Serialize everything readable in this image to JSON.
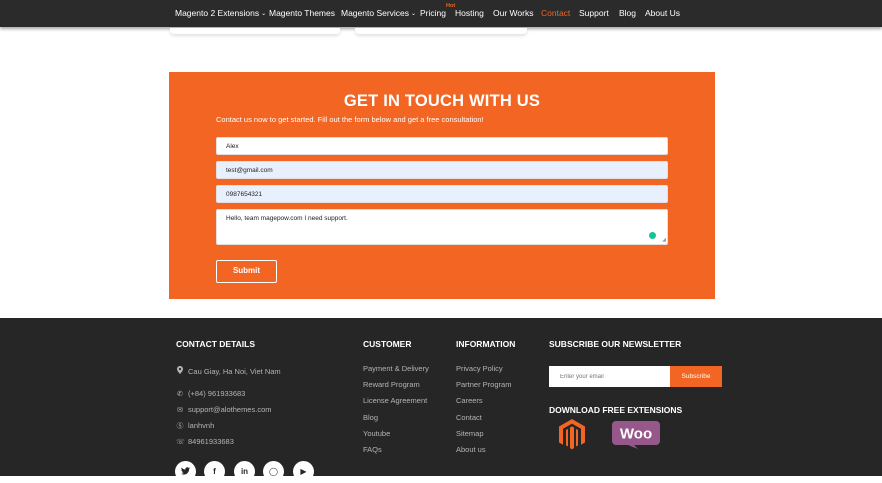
{
  "nav": {
    "items": [
      {
        "label": "Magento 2 Extensions",
        "caret": true
      },
      {
        "label": "Magento Themes"
      },
      {
        "label": "Magento Services",
        "caret": true
      },
      {
        "label": "Pricing"
      },
      {
        "label": "Hosting"
      },
      {
        "label": "Our Works"
      },
      {
        "label": "Contact",
        "active": true
      },
      {
        "label": "Support"
      },
      {
        "label": "Blog"
      },
      {
        "label": "About Us"
      }
    ],
    "hot_badge": "Hot"
  },
  "contact": {
    "title": "GET IN TOUCH WITH US",
    "intro": "Contact us now to get started. Fill out the form below and get a free consultation!",
    "name_value": "Alex",
    "email_value": "test@gmail.com",
    "phone_value": "0987654321",
    "message_value": "Hello, team magepow.com I need support.",
    "submit_label": "Submit"
  },
  "footer": {
    "contact_heading": "CONTACT DETAILS",
    "address": "Cau Giay, Ha Noi, Viet Nam",
    "phone": "(+84) 961933683",
    "email": "support@alothemes.com",
    "skype": "lanhvnh",
    "whatsapp": "84961933683",
    "customer_heading": "CUSTOMER",
    "customer_links": [
      "Payment & Delivery",
      "Reward Program",
      "License Agreement",
      "Blog",
      "Youtube",
      "FAQs"
    ],
    "information_heading": "INFORMATION",
    "information_links": [
      "Privacy Policy",
      "Partner Program",
      "Careers",
      "Contact",
      "Sitemap",
      "About us"
    ],
    "newsletter_heading": "SUBSCRIBE OUR NEWSLETTER",
    "newsletter_placeholder": "Enter your email",
    "subscribe_label": "Subscribe",
    "download_heading": "DOWNLOAD FREE EXTENSIONS",
    "woo_logo_text": "Woo",
    "icons": [
      "location-icon",
      "phone-icon",
      "email-icon",
      "skype-icon",
      "whatsapp-icon",
      "magento-logo",
      "woocommerce-logo"
    ],
    "social": [
      "twitter-icon",
      "facebook-icon",
      "linkedin-icon",
      "github-icon",
      "youtube-icon"
    ]
  },
  "colors": {
    "accent": "#f26522",
    "nav_bg": "#2b2b2b",
    "footer_bg": "#262626",
    "woo_purple": "#96588a"
  }
}
